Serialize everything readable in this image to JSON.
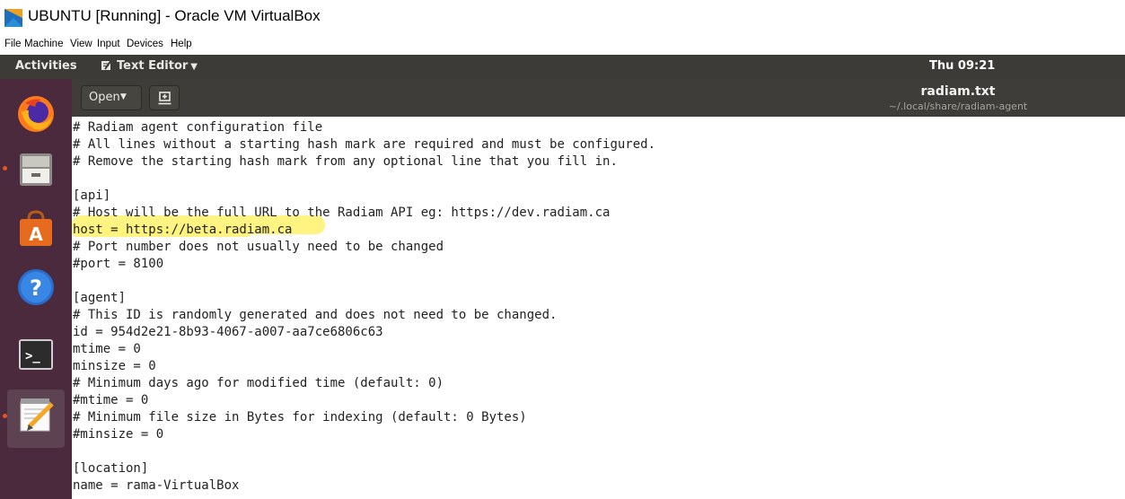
{
  "host_window": {
    "title": "UBUNTU [Running] - Oracle VM VirtualBox",
    "menu": [
      "File",
      "Machine",
      "View",
      "Input",
      "Devices",
      "Help"
    ]
  },
  "topbar": {
    "activities": "Activities",
    "app_name": "Text Editor",
    "clock": "Thu 09:21"
  },
  "dock": {
    "items": [
      "firefox-icon",
      "files-icon",
      "software-store-icon",
      "help-icon",
      "terminal-icon",
      "text-editor-icon"
    ]
  },
  "headerbar": {
    "open_label": "Open",
    "doc_title": "radiam.txt",
    "doc_path": "~/.local/share/radiam-agent"
  },
  "editor": {
    "lines": [
      "# Radiam agent configuration file",
      "# All lines without a starting hash mark are required and must be configured.",
      "# Remove the starting hash mark from any optional line that you fill in.",
      "",
      "[api]",
      "# Host will be the full URL to the Radiam API eg: https://dev.radiam.ca",
      "host = https://beta.radiam.ca",
      "# Port number does not usually need to be changed",
      "#port = 8100",
      "",
      "[agent]",
      "# This ID is randomly generated and does not need to be changed.",
      "id = 954d2e21-8b93-4067-a007-aa7ce6806c63",
      "mtime = 0",
      "minsize = 0",
      "# Minimum days ago for modified time (default: 0)",
      "#mtime = 0",
      "# Minimum file size in Bytes for indexing (default: 0 Bytes)",
      "#minsize = 0",
      "",
      "[location]",
      "name = rama-VirtualBox"
    ]
  },
  "colors": {
    "topbar": "#3c3b37",
    "dock": "#4a2a3c",
    "headerbar": "#3e3d39",
    "highlight": "#fff27a",
    "running_indicator": "#e95420"
  }
}
